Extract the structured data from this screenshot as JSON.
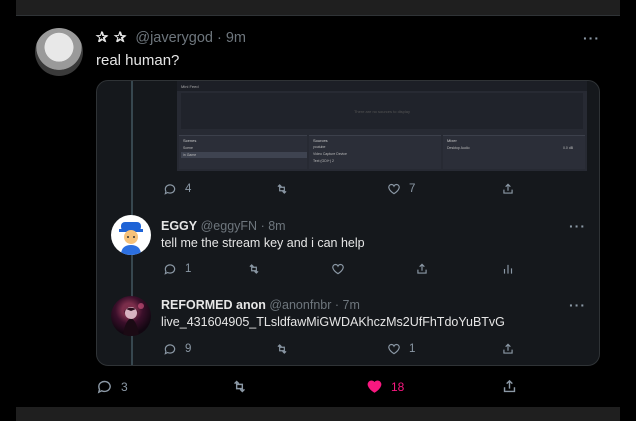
{
  "tweet": {
    "decoration": "✰ ✰",
    "handle": "@javerygod",
    "separator": "·",
    "time": "9m",
    "text": "real human?",
    "more": "···",
    "reply_count": "3",
    "retweet_count": "",
    "like_count": "18",
    "liked": true,
    "like_color": "#f91880"
  },
  "quote_media": {
    "title": "Mini Feed",
    "preview_placeholder": "There are no sources to display",
    "scenes_title": "Scenes",
    "scenes": [
      "Scene",
      "in Game"
    ],
    "sources_title": "Sources",
    "sources": [
      "youtube",
      "Video Capture Device",
      "Text (GDI+) 2"
    ],
    "mixer_title": "Mixer",
    "mixer_channel": "Desktop Audio",
    "mixer_level": "0.0 dB",
    "reply_count": "4",
    "like_count": "7"
  },
  "replies": [
    {
      "name": "EGGY",
      "handle": "@eggyFN",
      "separator": "·",
      "time": "8m",
      "text": "tell me the stream key and i can help",
      "reply_count": "1",
      "more": "···"
    },
    {
      "name": "REFORMED anon",
      "handle": "@anonfnbr",
      "separator": "·",
      "time": "7m",
      "text": "live_431604905_TLsldfawMiGWDAKhczMs2UfFhTdoYuBTvG",
      "reply_count": "9",
      "like_count": "1",
      "more": "···"
    }
  ],
  "colors": {
    "background": "#000000",
    "card": "#15181c",
    "muted": "#6e767d",
    "like": "#f91880"
  }
}
